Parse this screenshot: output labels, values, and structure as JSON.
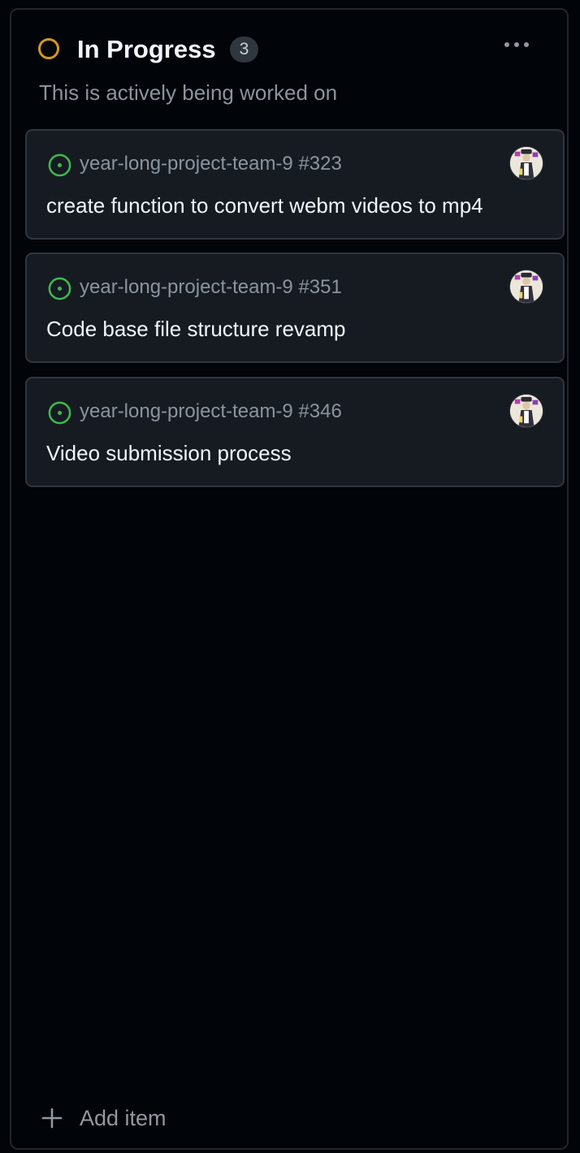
{
  "column": {
    "title": "In Progress",
    "count": "3",
    "description": "This is actively being worked on",
    "status_color": "#d29922",
    "more_icon": "kebab-horizontal-icon"
  },
  "cards": [
    {
      "repo": "year-long-project-team-9 #323",
      "title": "create function to convert webm videos to mp4",
      "status_icon": "issue-open-icon",
      "assignee_icon": "avatar"
    },
    {
      "repo": "year-long-project-team-9 #351",
      "title": "Code base file structure revamp",
      "status_icon": "issue-open-icon",
      "assignee_icon": "avatar"
    },
    {
      "repo": "year-long-project-team-9 #346",
      "title": "Video submission process",
      "status_icon": "issue-open-icon",
      "assignee_icon": "avatar"
    }
  ],
  "footer": {
    "add_label": "Add item",
    "add_icon": "plus-icon"
  },
  "colors": {
    "open_issue": "#3fb950",
    "background": "#010409",
    "card_background": "#161b22",
    "border": "#30363d"
  }
}
